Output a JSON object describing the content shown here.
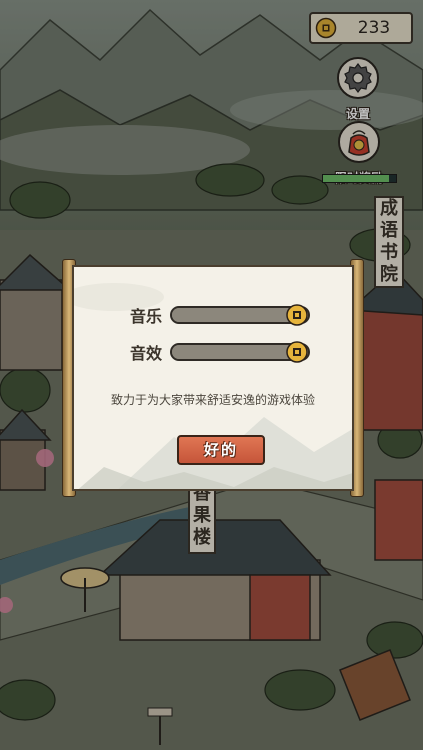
{
  "hud": {
    "coins": "233",
    "coin_icon": "coin-icon",
    "settings_label": "设置",
    "settings_icon": "gear-icon",
    "reward_label": "限时奖励",
    "reward_icon": "treasure-bag-icon",
    "reward_progress": 0.9
  },
  "map_signs": {
    "idiom_academy": [
      "成",
      "语",
      "书",
      "院"
    ],
    "fruit_shop": [
      "香",
      "果",
      "楼"
    ]
  },
  "settings_dialog": {
    "music_label": "音乐",
    "music_level": 1.0,
    "sound_label": "音效",
    "sound_level": 1.0,
    "slogan": "致力于为大家带来舒适安逸的游戏体验",
    "ok_label": "好的"
  },
  "colors": {
    "accent_button": "#d9664a",
    "paper": "#f4f1e8",
    "outline": "#3b342b"
  }
}
